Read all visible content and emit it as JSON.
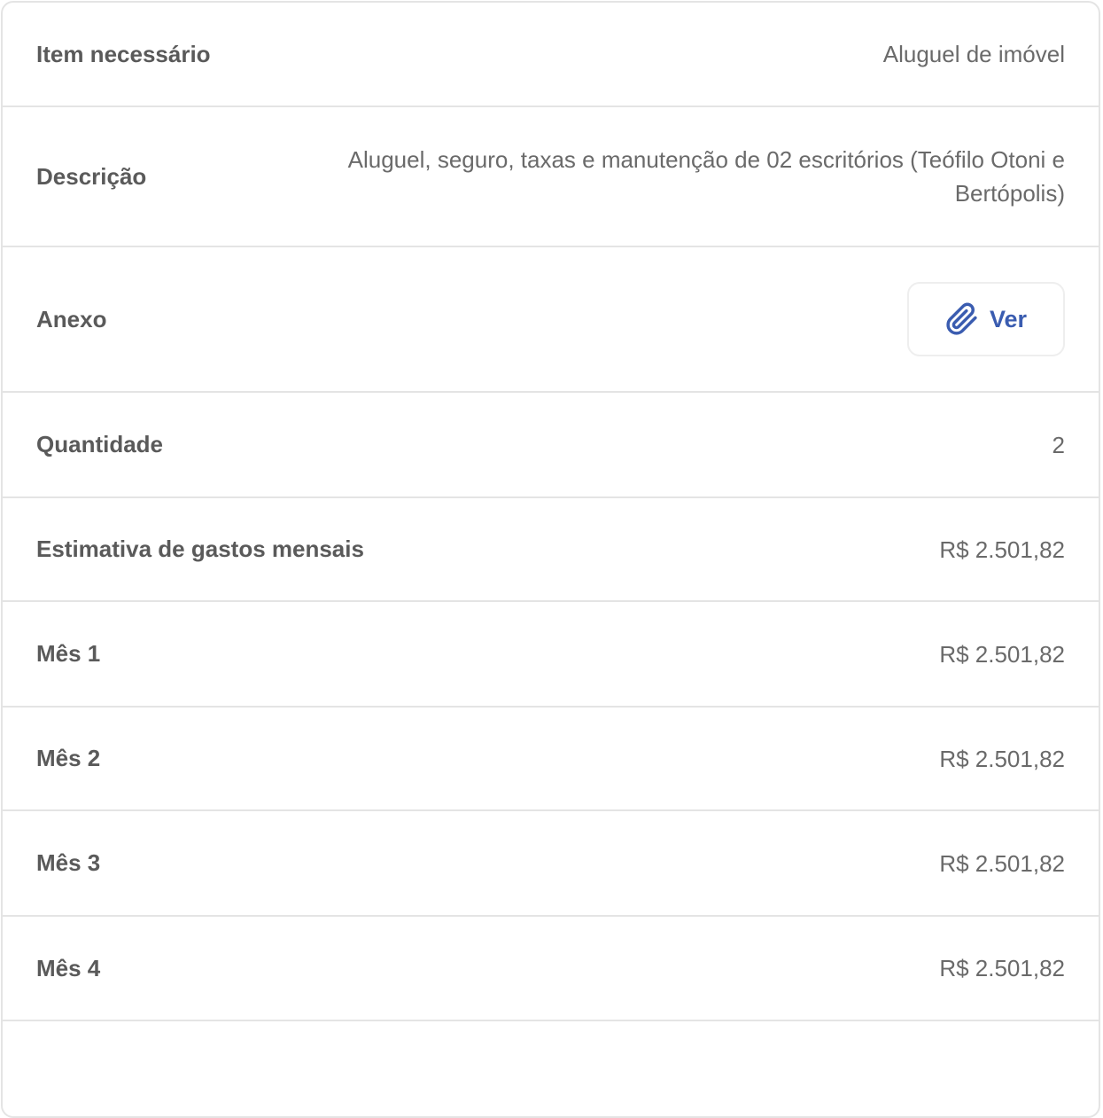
{
  "rows": {
    "item": {
      "label": "Item necessário",
      "value": "Aluguel de imóvel"
    },
    "description": {
      "label": "Descrição",
      "value": "Aluguel, seguro, taxas e manutenção de 02 escritórios (Teófilo Otoni e Bertópolis)"
    },
    "attachment": {
      "label": "Anexo",
      "button_label": "Ver",
      "button_icon": "paperclip-icon"
    },
    "quantity": {
      "label": "Quantidade",
      "value": "2"
    },
    "monthly_estimate": {
      "label": "Estimativa de gastos mensais",
      "value": "R$ 2.501,82"
    },
    "month1": {
      "label": "Mês 1",
      "value": "R$ 2.501,82"
    },
    "month2": {
      "label": "Mês 2",
      "value": "R$ 2.501,82"
    },
    "month3": {
      "label": "Mês 3",
      "value": "R$ 2.501,82"
    },
    "month4": {
      "label": "Mês 4",
      "value": "R$ 2.501,82"
    }
  },
  "colors": {
    "accent": "#3a5cb0",
    "border": "#e4e4e4",
    "label_text": "#5a5a5a",
    "value_text": "#6a6a6a"
  }
}
